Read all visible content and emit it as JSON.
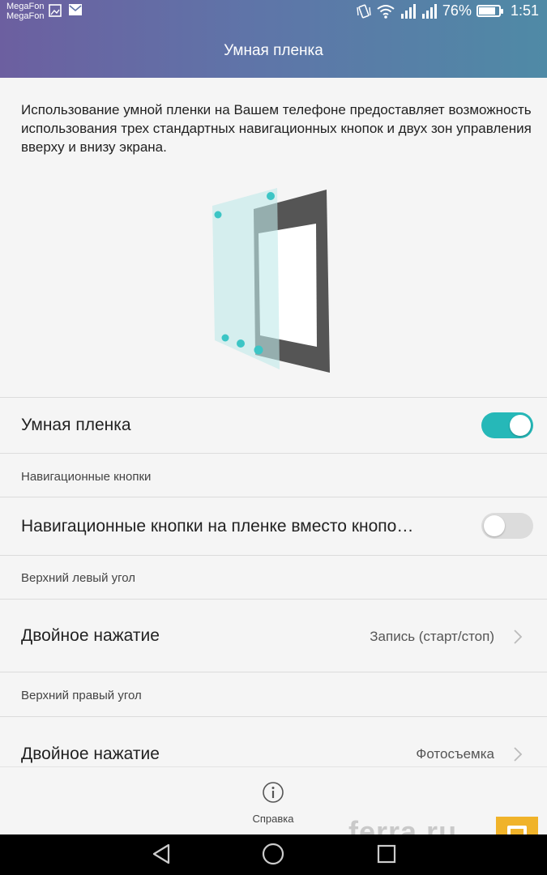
{
  "status_bar": {
    "carrier1": "MegaFon",
    "carrier2": "MegaFon",
    "battery_percent": "76%",
    "battery_level": 0.76,
    "time": "1:51",
    "icons": [
      "gallery-icon",
      "mail-icon",
      "vibrate-icon",
      "wifi-icon",
      "signal-icon",
      "signal-icon",
      "battery-icon"
    ]
  },
  "header": {
    "title": "Умная пленка"
  },
  "description": "Использование умной пленки на Вашем телефоне предоставляет возможность использования трех стандартных навигационных кнопок и двух зон управления вверху и внизу экрана.",
  "settings": {
    "smart_film": {
      "label": "Умная пленка",
      "enabled": true
    },
    "nav_section": {
      "label": "Навигационные кнопки"
    },
    "nav_buttons": {
      "label": "Навигационные кнопки на пленке вместо кнопо…",
      "enabled": false
    },
    "top_left_section": {
      "label": "Верхний левый угол"
    },
    "top_left_double_tap": {
      "label": "Двойное нажатие",
      "value": "Запись (старт/стоп)"
    },
    "top_right_section": {
      "label": "Верхний правый угол"
    },
    "top_right_double_tap": {
      "label": "Двойное нажатие",
      "value": "Фотосъемка"
    }
  },
  "help": {
    "label": "Справка",
    "icon": "info-icon"
  },
  "nav_bar": {
    "icons": [
      "back-icon",
      "home-icon",
      "recents-icon"
    ]
  },
  "watermark": {
    "text": "ferra.ru"
  },
  "colors": {
    "accent": "#26b8b8",
    "header_left": "#6c5fa0",
    "header_right": "#4f8aa6"
  }
}
